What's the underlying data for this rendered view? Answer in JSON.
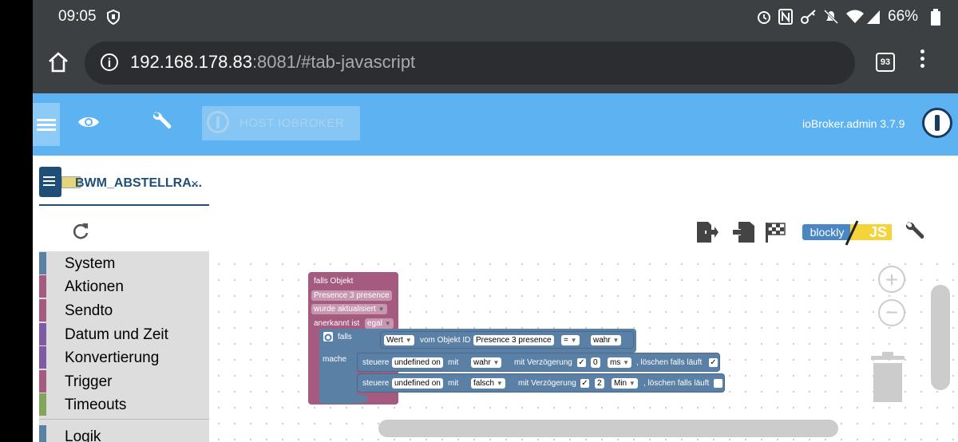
{
  "status_bar": {
    "time": "09:05",
    "battery": "66%",
    "icons": [
      "shield-icon",
      "alarm-icon",
      "nfc-icon",
      "key-icon",
      "mute-bell-icon",
      "wifi-icon",
      "signal-icon",
      "battery-icon"
    ]
  },
  "browser": {
    "url_host": "192.168.178.83",
    "url_rest": ":8081/#tab-javascript",
    "tab_count": "93"
  },
  "app_header": {
    "host_label": "HOST IOBROKER",
    "version": "ioBroker.admin 3.7.9"
  },
  "script_tab": {
    "label": "BWM_ABSTELLRA...",
    "close": "×"
  },
  "toolbar": {
    "blockly_label": "blockly",
    "js_label": "JS"
  },
  "categories": [
    {
      "label": "System",
      "color": "#5b80a5"
    },
    {
      "label": "Aktionen",
      "color": "#a55b80"
    },
    {
      "label": "Sendto",
      "color": "#a55b80"
    },
    {
      "label": "Datum und Zeit",
      "color": "#805ba5"
    },
    {
      "label": "Konvertierung",
      "color": "#805ba5"
    },
    {
      "label": "Trigger",
      "color": "#a55b80"
    },
    {
      "label": "Timeouts",
      "color": "#80a55b"
    },
    {
      "label": "Logik",
      "color": "#5b80a5"
    }
  ],
  "blocks": {
    "trigger": {
      "title": "falls Objekt",
      "object": "Presence 3 presence",
      "event": "wurde aktualisiert",
      "ack_label": "anerkannt ist",
      "ack_value": "egal"
    },
    "if_block": {
      "if_label": "falls",
      "do_label": "mache"
    },
    "compare": {
      "left_type": "Wert",
      "from_label": "vom Objekt ID",
      "object": "Presence 3 presence",
      "operator": "=",
      "right_value": "wahr"
    },
    "control1": {
      "label": "steuere",
      "target": "undefined on",
      "with_label": "mit",
      "value": "wahr",
      "delay_label": "mit Verzögerung",
      "delay": "0",
      "unit": "ms",
      "clear_label": ", löschen falls läuft"
    },
    "control2": {
      "label": "steuere",
      "target": "undefined on",
      "with_label": "mit",
      "value": "falsch",
      "delay_label": "mit Verzögerung",
      "delay": "2",
      "unit": "Min",
      "clear_label": ", löschen falls läuft"
    },
    "dropdown_arrow": "▼",
    "check_mark": "✓"
  },
  "colors": {
    "header_blue": "#5db2f2",
    "trigger_block": "#a55b80",
    "logic_block": "#5b80a5",
    "dark_blue": "#1f4e79"
  }
}
